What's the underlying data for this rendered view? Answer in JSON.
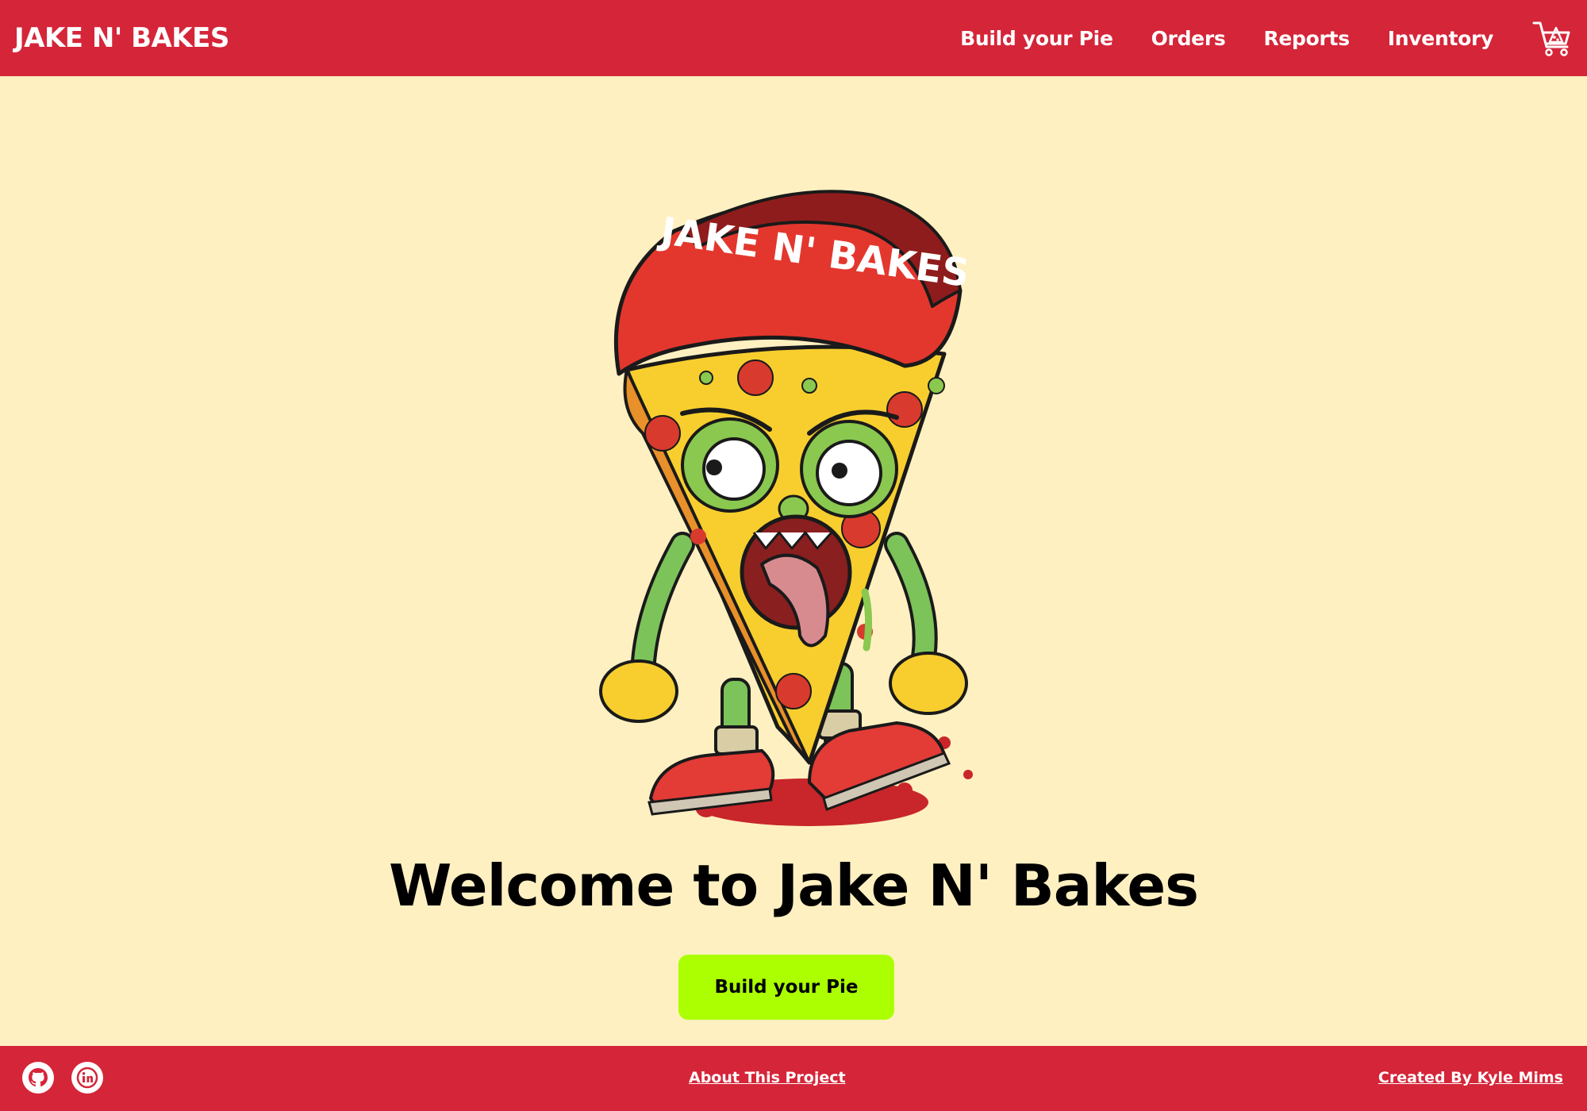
{
  "header": {
    "brand": "JAKE N' BAKES",
    "nav": [
      {
        "label": "Build your Pie"
      },
      {
        "label": "Orders"
      },
      {
        "label": "Reports"
      },
      {
        "label": "Inventory"
      }
    ],
    "cart_icon": "shopping-cart-icon"
  },
  "hero": {
    "mascot": {
      "icon": "zombie-pizza-mascot",
      "hat_text": "JAKE N' BAKES"
    },
    "welcome": "Welcome to Jake N' Bakes",
    "cta_label": "Build your Pie"
  },
  "footer": {
    "social": [
      {
        "icon": "github-icon"
      },
      {
        "icon": "linkedin-icon"
      }
    ],
    "about_label": "About This Project",
    "credit_label": "Created By Kyle Mims"
  },
  "colors": {
    "header_bg": "#D52539",
    "page_bg": "#FFF0C1",
    "cta_bg": "#ABFF00",
    "text_dark": "#000000",
    "text_light": "#FFFFFF"
  }
}
